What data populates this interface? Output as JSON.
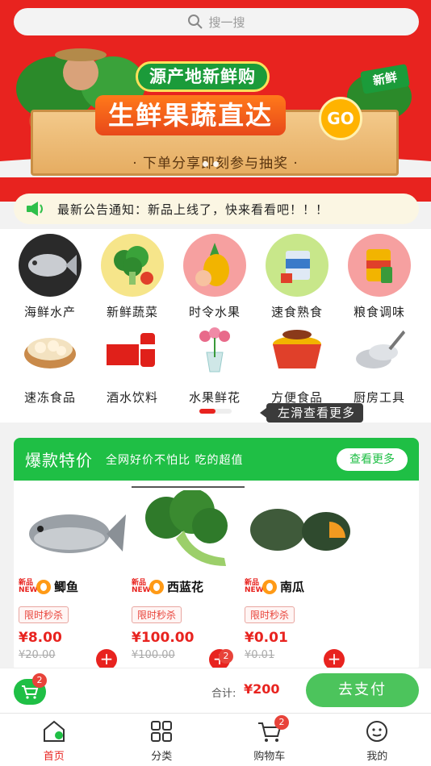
{
  "search": {
    "placeholder": "搜一搜"
  },
  "banner": {
    "pill": "源产地新鲜购",
    "title": "生鲜果蔬直达",
    "go": "GO",
    "tag": "新鲜",
    "subtitle": "· 下单分享即刻参与抽奖 ·"
  },
  "notice": {
    "text": "最新公告通知：新品上线了，快来看看吧！！！"
  },
  "categories": [
    {
      "label": "海鲜水产",
      "icon": "fish-icon"
    },
    {
      "label": "新鲜蔬菜",
      "icon": "broccoli-icon"
    },
    {
      "label": "时令水果",
      "icon": "pineapple-icon"
    },
    {
      "label": "速食熟食",
      "icon": "instant-food-icon"
    },
    {
      "label": "粮食调味",
      "icon": "grain-icon"
    },
    {
      "label": "速冻食品",
      "icon": "dumpling-icon"
    },
    {
      "label": "酒水饮料",
      "icon": "cola-icon"
    },
    {
      "label": "水果鲜花",
      "icon": "flower-icon"
    },
    {
      "label": "方便食品",
      "icon": "noodle-icon"
    },
    {
      "label": "厨房工具",
      "icon": "pot-icon"
    }
  ],
  "swipe_tip": "左滑查看更多",
  "hot": {
    "title": "爆款特价",
    "subtitle": "全网好价不怕比 吃的超值",
    "more": "查看更多",
    "products": [
      {
        "name": "鲫鱼",
        "tag": "限时秒杀",
        "price": "¥8.00",
        "old_price": "¥20.00"
      },
      {
        "name": "西蓝花",
        "tag": "限时秒杀",
        "price": "¥100.00",
        "old_price": "¥100.00",
        "cart_count": "2"
      },
      {
        "name": "南瓜",
        "tag": "限时秒杀",
        "price": "¥0.01",
        "old_price": "¥0.01"
      }
    ],
    "new_badge": "新品 NEW"
  },
  "checkout": {
    "cart_count": "2",
    "total_label": "合计:",
    "total_value": "¥200",
    "pay": "去支付"
  },
  "tabbar": [
    {
      "label": "首页",
      "icon": "home-icon"
    },
    {
      "label": "分类",
      "icon": "grid-icon"
    },
    {
      "label": "购物车",
      "icon": "cart-icon",
      "badge": "2"
    },
    {
      "label": "我的",
      "icon": "smile-icon"
    }
  ],
  "colors": {
    "brand_red": "#e8231f",
    "brand_green": "#1fbf45"
  }
}
